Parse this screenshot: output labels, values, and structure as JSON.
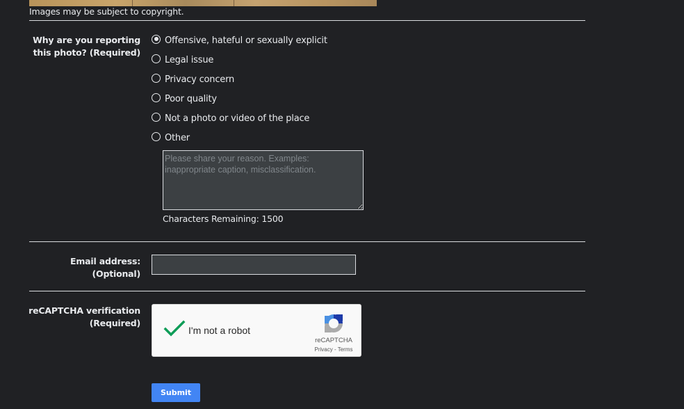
{
  "photo": {
    "copyright_notice": "Images may be subject to copyright."
  },
  "reason_section": {
    "label_line1": "Why are you reporting",
    "label_line2": "this photo? (Required)",
    "options": [
      {
        "label": "Offensive, hateful or sexually explicit",
        "checked": true
      },
      {
        "label": "Legal issue",
        "checked": false
      },
      {
        "label": "Privacy concern",
        "checked": false
      },
      {
        "label": "Poor quality",
        "checked": false
      },
      {
        "label": "Not a photo or video of the place",
        "checked": false
      },
      {
        "label": "Other",
        "checked": false
      }
    ],
    "textarea_value": "",
    "textarea_placeholder": "Please share your reason. Examples: inappropriate caption, misclassification.",
    "chars_remaining_label": "Characters Remaining: 1500"
  },
  "email_section": {
    "label_line1": "Email address:",
    "label_line2": "(Optional)",
    "value": "",
    "placeholder": ""
  },
  "recaptcha_section": {
    "label_line1": "reCAPTCHA verification",
    "label_line2": "(Required)",
    "checkbox_label": "I'm not a robot",
    "verified": true,
    "brand": "reCAPTCHA",
    "privacy_link": "Privacy",
    "separator": " - ",
    "terms_link": "Terms",
    "check_color": "#0f9d58"
  },
  "submit": {
    "label": "Submit",
    "color": "#4285f4"
  }
}
